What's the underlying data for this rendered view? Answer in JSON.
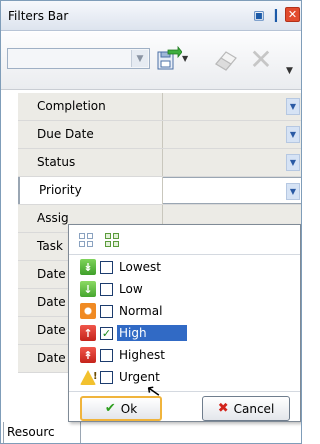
{
  "window": {
    "title": "Filters Bar",
    "buttons": {
      "restore_icon": "restore-icon",
      "pin_icon": "pin-icon",
      "close_icon": "close-icon"
    }
  },
  "toolbar": {
    "combo_value": "",
    "icons": [
      "save-filter-icon",
      "eraser-icon",
      "clear-filter-icon"
    ]
  },
  "filters": {
    "rows": [
      {
        "label": "Completion"
      },
      {
        "label": "Due Date"
      },
      {
        "label": "Status"
      },
      {
        "label": "Priority"
      },
      {
        "label": "Assig"
      },
      {
        "label": "Task"
      },
      {
        "label": "Date"
      },
      {
        "label": "Date"
      },
      {
        "label": "Date"
      },
      {
        "label": "Date"
      }
    ]
  },
  "bottom_tab": {
    "label": "Resourc"
  },
  "priority_popup": {
    "options": [
      {
        "label": "Lowest",
        "checked": false,
        "icon": "priority-lowest-icon"
      },
      {
        "label": "Low",
        "checked": false,
        "icon": "priority-low-icon"
      },
      {
        "label": "Normal",
        "checked": false,
        "icon": "priority-normal-icon"
      },
      {
        "label": "High",
        "checked": true,
        "icon": "priority-high-icon"
      },
      {
        "label": "Highest",
        "checked": false,
        "icon": "priority-highest-icon"
      },
      {
        "label": "Urgent",
        "checked": false,
        "icon": "priority-urgent-icon"
      }
    ],
    "ok_label": "Ok",
    "cancel_label": "Cancel"
  },
  "colors": {
    "selection": "#316ac5",
    "header_bg": "#ecebe6",
    "accent_blue": "#1c5aa8"
  }
}
